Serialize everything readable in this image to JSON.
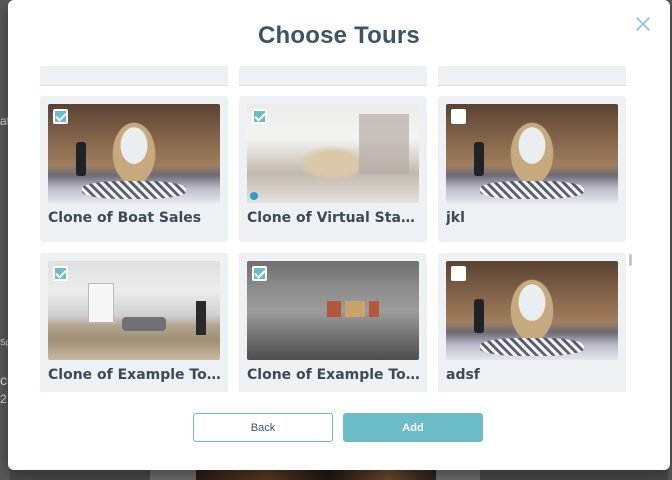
{
  "modal": {
    "title": "Choose Tours",
    "close_icon": "close-icon"
  },
  "background": {
    "left_texts": [
      "at",
      "Sp",
      "cl",
      "2"
    ]
  },
  "tours": [
    {
      "name": "Clone of Boat Sales",
      "checked": true,
      "thumbnail": "hallway-panorama"
    },
    {
      "name": "Clone of Virtual Staging",
      "checked": true,
      "thumbnail": "staging-panorama"
    },
    {
      "name": "jkl",
      "checked": false,
      "thumbnail": "hallway-panorama"
    },
    {
      "name": "Clone of Example Tour Clou...",
      "checked": true,
      "thumbnail": "living-room-panorama"
    },
    {
      "name": "Clone of Example Tour Clou...",
      "checked": true,
      "thumbnail": "gallery-panorama"
    },
    {
      "name": "adsf",
      "checked": false,
      "thumbnail": "hallway-panorama"
    }
  ],
  "actions": {
    "back_label": "Back",
    "add_label": "Add"
  },
  "colors": {
    "accent": "#6bbcc6",
    "title": "#3c5468",
    "card_bg": "#eef1f3"
  }
}
